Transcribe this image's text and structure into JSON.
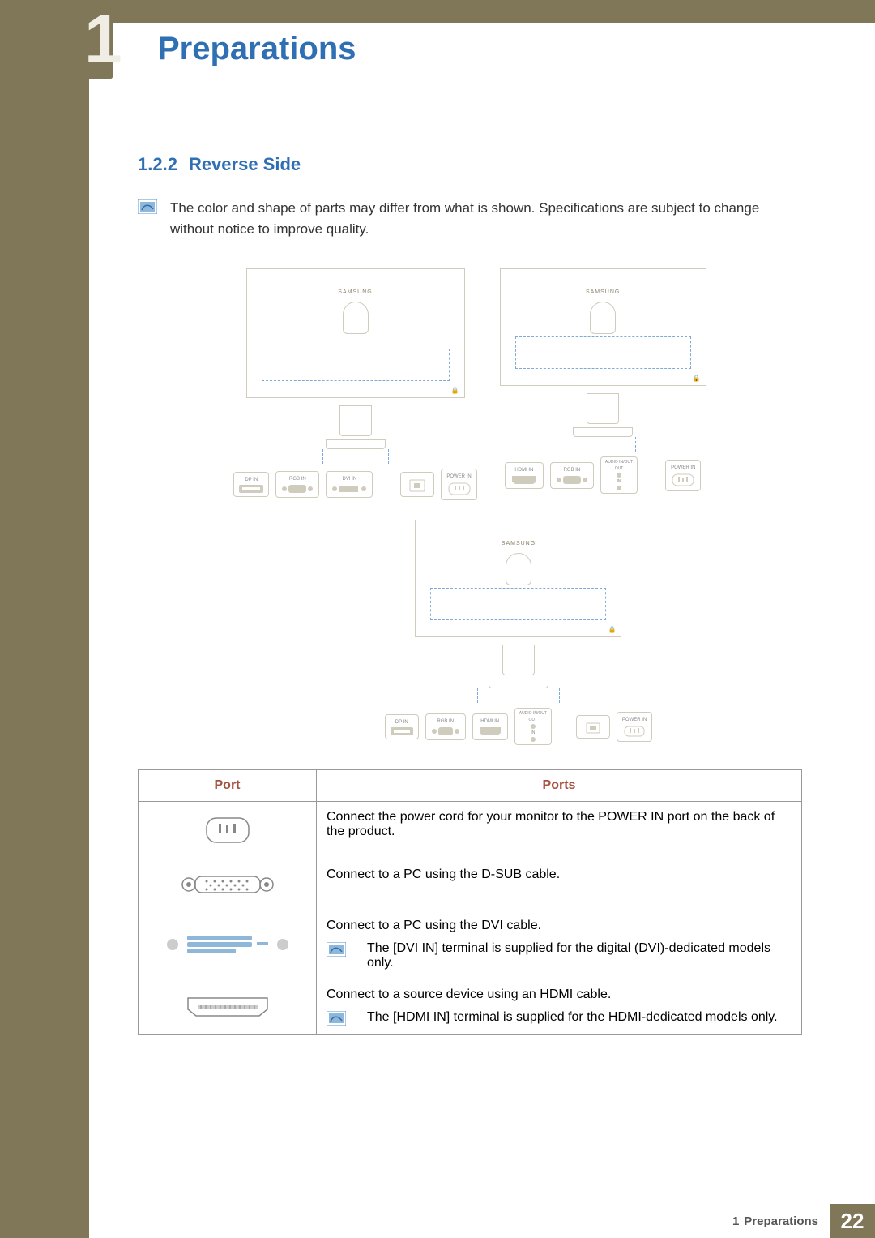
{
  "chapter_number": "1",
  "page_title": "Preparations",
  "section": {
    "number": "1.2.2",
    "title": "Reverse Side"
  },
  "note_text": "The color and shape of parts may differ from what is shown. Specifications are subject to change without notice to improve quality.",
  "diagram": {
    "brand": "SAMSUNG",
    "model1_ports": {
      "dp": "DP IN",
      "rgb": "RGB IN",
      "dvi": "DVI IN",
      "power": "POWER IN"
    },
    "model2_ports": {
      "hdmi": "HDMI IN",
      "rgb": "RGB IN",
      "audio": "AUDIO IN/OUT",
      "audio_out": "OUT",
      "audio_in": "IN",
      "power": "POWER IN"
    },
    "model3_ports": {
      "dp": "DP IN",
      "rgb": "RGB IN",
      "hdmi": "HDMI IN",
      "audio": "AUDIO IN/OUT",
      "audio_out": "OUT",
      "audio_in": "IN",
      "power": "POWER IN"
    }
  },
  "table": {
    "header_port": "Port",
    "header_ports": "Ports",
    "rows": [
      {
        "icon": "power",
        "desc": "Connect the power cord for your monitor to the POWER IN port on the back of the product."
      },
      {
        "icon": "dsub",
        "desc": "Connect to a PC using the D-SUB cable."
      },
      {
        "icon": "dvi",
        "desc_main": "Connect to a PC using the DVI cable.",
        "note": "The [DVI IN] terminal is supplied for the digital (DVI)-dedicated models only."
      },
      {
        "icon": "hdmi",
        "desc_main": "Connect to a source device using an HDMI cable.",
        "note": "The [HDMI IN] terminal is supplied for the HDMI-dedicated models only."
      }
    ]
  },
  "footer": {
    "chapter_num": "1",
    "chapter_title": "Preparations",
    "page_number": "22"
  }
}
